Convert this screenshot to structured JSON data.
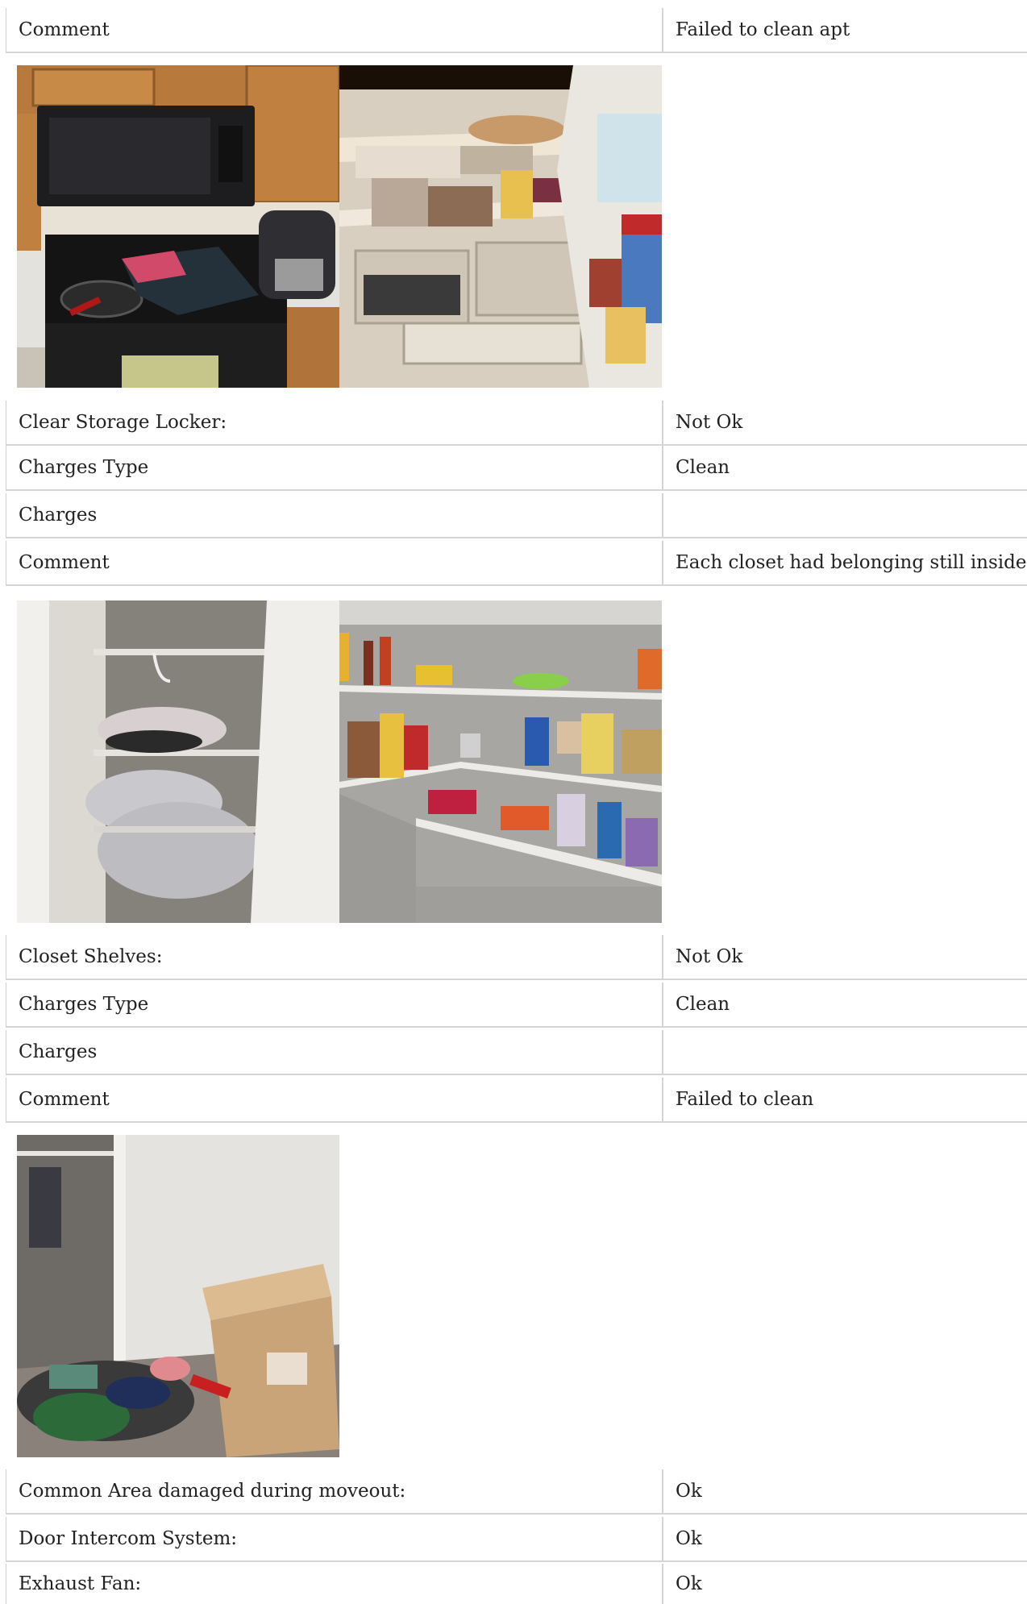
{
  "rows_top": [
    {
      "label": "Comment",
      "value": "Failed to clean apt"
    }
  ],
  "storage": [
    {
      "label": "Clear Storage Locker:",
      "value": "Not Ok"
    },
    {
      "label": "Charges Type",
      "value": "Clean"
    },
    {
      "label": "Charges",
      "value": ""
    },
    {
      "label": "Comment",
      "value": "Each closet had belonging still inside"
    }
  ],
  "closet": [
    {
      "label": "Closet Shelves:",
      "value": "Not Ok"
    },
    {
      "label": "Charges Type",
      "value": "Clean"
    },
    {
      "label": "Charges",
      "value": ""
    },
    {
      "label": "Comment",
      "value": "Failed to clean"
    }
  ],
  "common": [
    {
      "label": "Common Area damaged during moveout:",
      "value": "Ok"
    },
    {
      "label": "Door Intercom System:",
      "value": "Ok"
    },
    {
      "label": "Exhaust Fan:",
      "value": "Ok"
    }
  ]
}
